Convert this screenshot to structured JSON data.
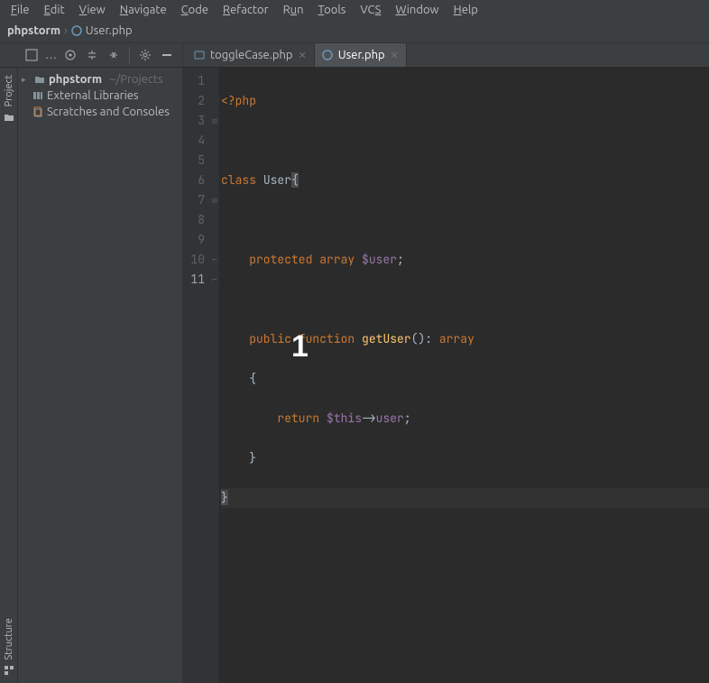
{
  "menu": {
    "items": [
      {
        "mnemonic": "F",
        "rest": "ile"
      },
      {
        "mnemonic": "E",
        "rest": "dit"
      },
      {
        "mnemonic": "V",
        "rest": "iew"
      },
      {
        "mnemonic": "N",
        "rest": "avigate"
      },
      {
        "mnemonic": "C",
        "rest": "ode"
      },
      {
        "mnemonic": "R",
        "rest": "efactor"
      },
      {
        "mnemonic": "R",
        "rest": "un",
        "under_index": 1,
        "label": "Run"
      },
      {
        "mnemonic": "T",
        "rest": "ools"
      },
      {
        "mnemonic": "VC",
        "rest": "S",
        "label": "VCS",
        "under_last": true
      },
      {
        "mnemonic": "W",
        "rest": "indow"
      },
      {
        "mnemonic": "H",
        "rest": "elp"
      }
    ]
  },
  "breadcrumb": {
    "project": "phpstorm",
    "file": "User.php"
  },
  "tabs": [
    {
      "label": "toggleCase.php",
      "active": false
    },
    {
      "label": "User.php",
      "active": true
    }
  ],
  "sidebar": {
    "top_label": "Project",
    "bottom_label": "Structure"
  },
  "tree": {
    "project_name": "phpstorm",
    "project_path": "~/Projects",
    "external_libs": "External Libraries",
    "scratches": "Scratches and Consoles"
  },
  "editor": {
    "lines": [
      "1",
      "2",
      "3",
      "4",
      "5",
      "6",
      "7",
      "8",
      "9",
      "10",
      "11"
    ],
    "overlay_char": "1",
    "code": {
      "l1_tag": "<?php",
      "l3_kw_class": "class",
      "l3_name": "User",
      "l3_brace": "{",
      "l5_kw_prot": "protected",
      "l5_kw_arr": "array",
      "l5_var": "$user",
      "l5_semi": ";",
      "l7_kw_pub": "public",
      "l7_kw_fn": "function",
      "l7_fn": "getUser",
      "l7_sig": "():",
      "l7_ret": "array",
      "l8_brace": "{",
      "l9_kw_ret": "return",
      "l9_this": "$this",
      "l9_arrow": "->",
      "l9_prop": "user",
      "l9_semi": ";",
      "l10_brace": "}",
      "l11_brace": "}"
    }
  }
}
